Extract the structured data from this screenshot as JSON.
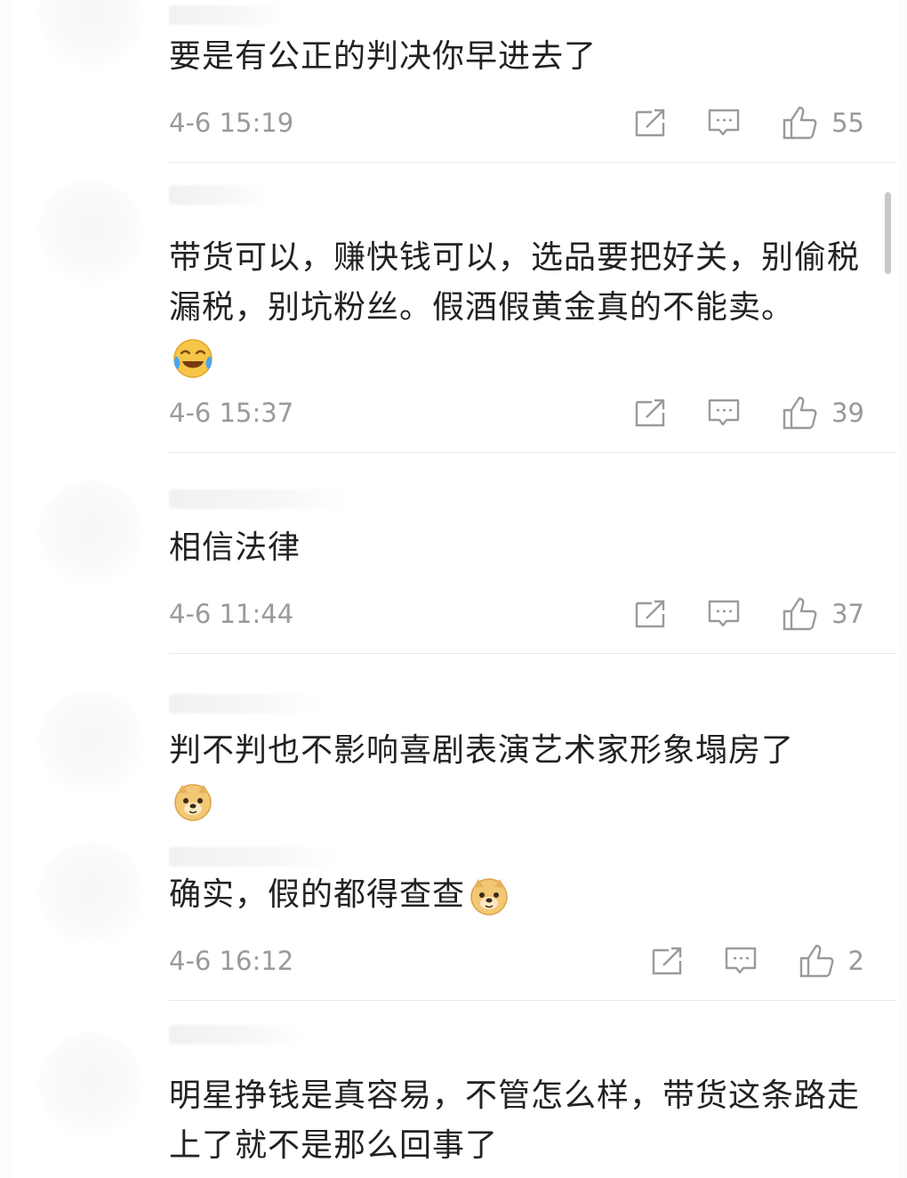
{
  "comments": [
    {
      "text": "要是有公正的判决你早进去了",
      "time": "4-6 15:19",
      "likes": "55",
      "emoji": []
    },
    {
      "text": "带货可以，赚快钱可以，选品要把好关，别偷税漏税，别坑粉丝。假酒假黄金真的不能卖。",
      "time": "4-6 15:37",
      "likes": "39",
      "emoji": [
        "laugh-cry-emoji"
      ]
    },
    {
      "text": "相信法律",
      "time": "4-6 11:44",
      "likes": "37",
      "emoji": []
    },
    {
      "text": "判不判也不影响喜剧表演艺术家形象塌房了",
      "time": "",
      "likes": "",
      "emoji": [
        "doge-emoji"
      ]
    },
    {
      "text": "确实，假的都得查查",
      "time": "4-6 16:12",
      "likes": "2",
      "emoji": [
        "doge-emoji"
      ]
    },
    {
      "text": "明星挣钱是真容易，不管怎么样，带货这条路走上了就不是那么回事了",
      "time": "",
      "likes": "",
      "emoji": []
    }
  ],
  "icons": {
    "share": "share-icon",
    "reply": "comment-icon",
    "like": "thumbs-up-icon"
  },
  "colors": {
    "text": "#222222",
    "meta": "#9a9a9a",
    "divider": "#e9e9e9"
  }
}
